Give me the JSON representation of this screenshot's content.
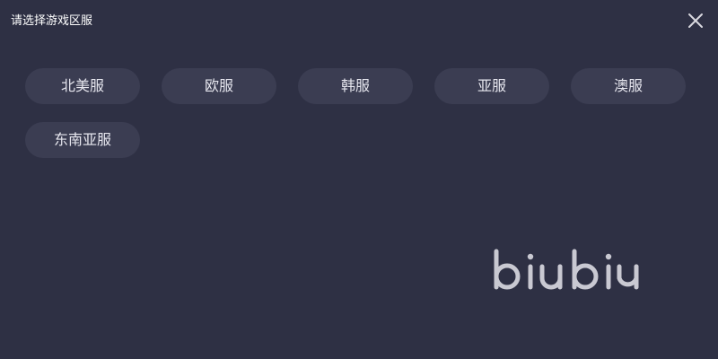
{
  "dialog": {
    "title": "请选择游戏区服"
  },
  "icons": {
    "close": "close-icon"
  },
  "regions": [
    {
      "label": "北美服"
    },
    {
      "label": "欧服"
    },
    {
      "label": "韩服"
    },
    {
      "label": "亚服"
    },
    {
      "label": "澳服"
    },
    {
      "label": "东南亚服"
    }
  ],
  "brand": {
    "logo_text": "biubiu"
  },
  "colors": {
    "background": "#2e3044",
    "button": "#3b3d52",
    "button_text": "#e6e6ee",
    "logo": "#c9c9d2"
  }
}
